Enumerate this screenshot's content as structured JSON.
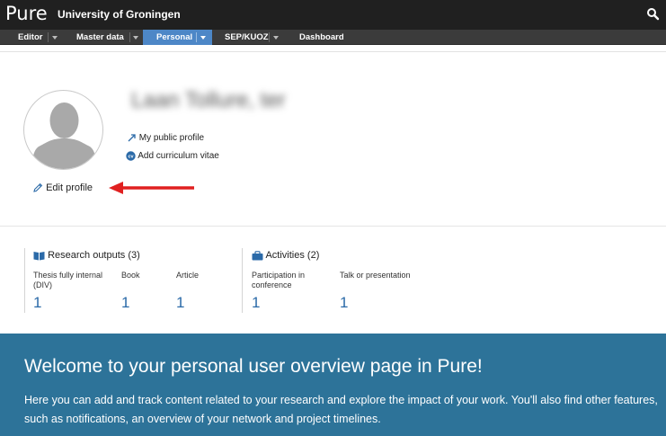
{
  "header": {
    "logo": "Pure",
    "organization": "University of Groningen",
    "search_icon": "search-icon"
  },
  "nav": {
    "tabs": [
      {
        "label": "Editor",
        "active": false
      },
      {
        "label": "Master data",
        "active": false
      },
      {
        "label": "Personal",
        "active": true
      },
      {
        "label": "SEP/KUOZ",
        "active": false
      },
      {
        "label": "Dashboard",
        "active": false
      }
    ]
  },
  "profile": {
    "name": "Laan Tollure, ter",
    "links": {
      "public_profile": "My public profile",
      "add_cv": "Add curriculum vitae",
      "edit_profile": "Edit profile"
    },
    "icons": [
      "avatar-placeholder-icon",
      "external-arrow-icon",
      "cv-icon",
      "pencil-icon"
    ]
  },
  "research_outputs": {
    "heading": "Research outputs (3)",
    "icon": "book-icon",
    "items": [
      {
        "label": "Thesis fully internal (DIV)",
        "count": "1"
      },
      {
        "label": "Book",
        "count": "1"
      },
      {
        "label": "Article",
        "count": "1"
      }
    ]
  },
  "activities": {
    "heading": "Activities (2)",
    "icon": "briefcase-icon",
    "items": [
      {
        "label": "Participation in conference",
        "count": "1"
      },
      {
        "label": "Talk or presentation",
        "count": "1"
      }
    ]
  },
  "welcome": {
    "title": "Welcome to your personal user overview page in Pure!",
    "text": "Here you can add and track content related to your research and explore the impact of your work. You'll also find other features, such as notifications, an overview of your network and project timelines."
  },
  "colors": {
    "topbar": "#202020",
    "navbar": "#3b3b3b",
    "active_tab": "#4d87c7",
    "link_blue": "#2b6aa8",
    "banner": "#2d7399",
    "annotation_arrow": "#e02020"
  }
}
